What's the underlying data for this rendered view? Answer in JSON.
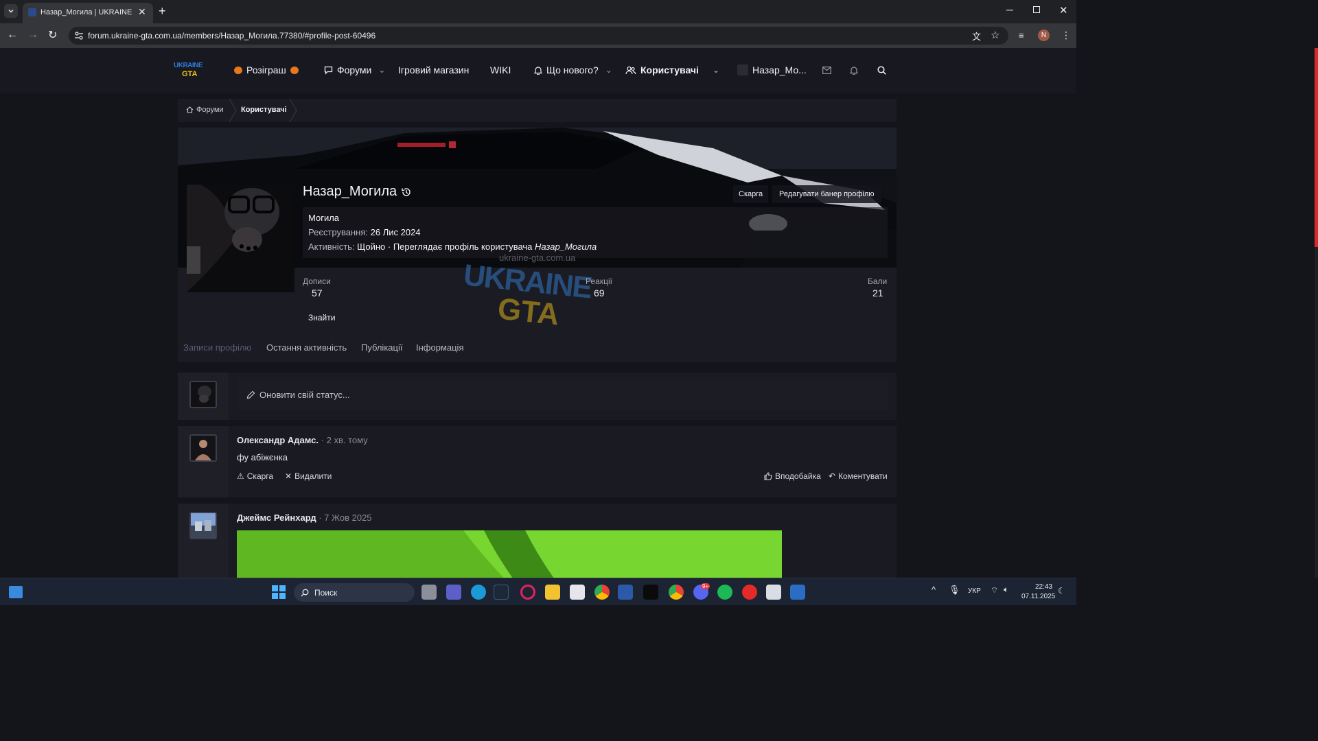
{
  "browser": {
    "tab_title": "Назар_Могила | UKRAINE GTA",
    "url": "forum.ukraine-gta.com.ua/members/Назар_Могила.77380/#profile-post-60496",
    "profile_initial": "N"
  },
  "site": {
    "logo_text_line1": "UKRAINE",
    "logo_text_line2": "GTA",
    "nav": {
      "giveaway": "Розіграш",
      "forums": "Форуми",
      "shop": "Ігровий магазин",
      "wiki": "WIKI",
      "whats_new": "Що нового?",
      "users": "Користувачі",
      "account": "Назар_Мо..."
    },
    "breadcrumb": [
      "Форуми",
      "Користувачі"
    ],
    "profile": {
      "username": "Назар_Могила",
      "title": "Могила",
      "registered_label": "Реєстрування:",
      "registered_value": "26 Лис 2024",
      "activity_label": "Активність:",
      "activity_value": "Щойно · Переглядає профіль користувача",
      "activity_target": "Назар_Могила",
      "report_button": "Скарга",
      "edit_banner_button": "Редагувати банер профілю",
      "watermark_url": "ukraine-gta.com.ua",
      "stats": [
        {
          "label": "Дописи",
          "value": "57"
        },
        {
          "label": "Реакції",
          "value": "69"
        },
        {
          "label": "Бали",
          "value": "21"
        }
      ],
      "find_button": "Знайти",
      "tabs": [
        "Записи профілю",
        "Остання активність",
        "Публікації",
        "Інформація"
      ]
    },
    "status_placeholder": "Оновити свій статус...",
    "posts": [
      {
        "author": "Олександр Адамс.",
        "time": "2 хв. тому",
        "text": "фу абіжєнка",
        "report": "Скарга",
        "delete": "Видалити",
        "like": "Вподобайка",
        "comment": "Коментувати"
      },
      {
        "author": "Джеймс Рейнхард",
        "time": "7 Жов 2025"
      }
    ]
  },
  "taskbar": {
    "search_placeholder": "Поиск",
    "language": "УКР",
    "time": "22:43",
    "date": "07.11.2025",
    "discord_badge": "9+"
  },
  "colors": {
    "accent_red": "#d62c2c",
    "active_tab": "#5a5a78",
    "post_image_green": "#6fd12c"
  }
}
